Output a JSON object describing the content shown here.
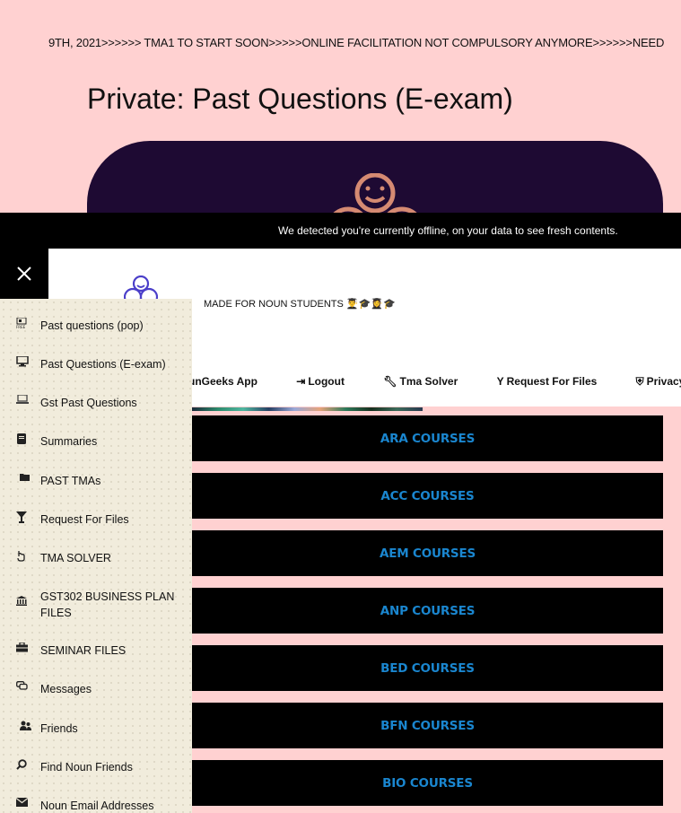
{
  "ticker": {
    "text": "9TH, 2021>>>>>> TMA1 TO START SOON>>>>>ONLINE FACILITATION NOT COMPULSORY ANYMORE>>>>>>NEED"
  },
  "page": {
    "title": "Private: Past Questions (E-exam)"
  },
  "offline_banner": {
    "message": "We detected you're currently offline, on your data to see fresh contents."
  },
  "header": {
    "tagline": "MADE FOR NOUN STUDENTS 👨‍🎓🎓👩‍🎓🎓"
  },
  "topnav": {
    "items": [
      {
        "label": "unGeeks App",
        "icon": ""
      },
      {
        "label": "Logout",
        "icon": "⇥"
      },
      {
        "label": "Tma Solver",
        "icon": "🔧"
      },
      {
        "label": "Request For Files",
        "icon": "Y"
      },
      {
        "label": "Privacy Po",
        "icon": "shield"
      }
    ]
  },
  "sidebar": {
    "close_icon": "close-icon",
    "items": [
      {
        "label": "Past questions (pop)",
        "icon": "free-badge-icon"
      },
      {
        "label": "Past Questions (E-exam)",
        "icon": "monitor-icon"
      },
      {
        "label": "Gst Past Questions",
        "icon": "laptop-icon"
      },
      {
        "label": "Summaries",
        "icon": "book-icon"
      },
      {
        "label": "PAST TMAs",
        "icon": "folder-icon"
      },
      {
        "label": "Request For Files",
        "icon": "cocktail-icon"
      },
      {
        "label": "TMA SOLVER",
        "icon": "hand-pointer-icon"
      },
      {
        "label": "GST302 BUSINESS PLAN FILES",
        "icon": "bank-icon"
      },
      {
        "label": "SEMINAR FILES",
        "icon": "briefcase-icon"
      },
      {
        "label": "Messages",
        "icon": "chat-icon"
      },
      {
        "label": "Friends",
        "icon": "users-icon"
      },
      {
        "label": "Find Noun Friends",
        "icon": "search-icon"
      },
      {
        "label": "Noun Email Addresses",
        "icon": "envelope-icon"
      }
    ]
  },
  "courses": [
    {
      "label": "ARA COURSES"
    },
    {
      "label": "ACC COURSES"
    },
    {
      "label": "AEM COURSES"
    },
    {
      "label": "ANP COURSES"
    },
    {
      "label": "BED COURSES"
    },
    {
      "label": "BFN COURSES"
    },
    {
      "label": "BIO COURSES"
    }
  ],
  "colors": {
    "page_bg": "#ffd1d1",
    "hero_bg": "#1e0a33",
    "hero_logo": "#d58a72",
    "course_text": "#1a86cf",
    "sidebar_bg": "#f1ecdc",
    "logo_purple": "#4b3fc9"
  }
}
